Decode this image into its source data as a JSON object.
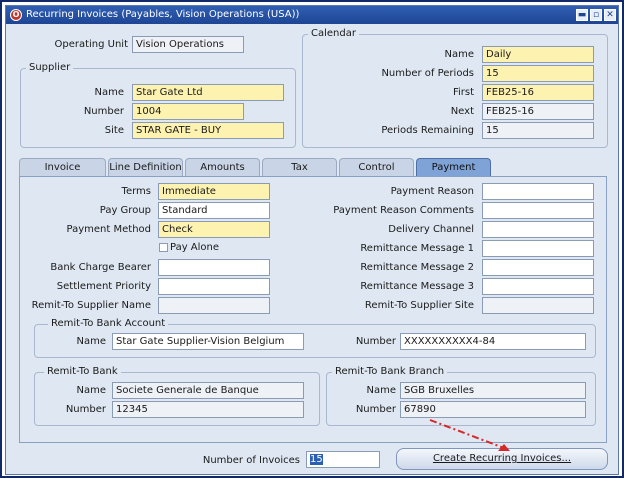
{
  "window": {
    "title": "Recurring Invoices (Payables, Vision Operations (USA))",
    "title_icon": "O",
    "buttons": {
      "minimize": "▬",
      "restore": "▫",
      "close": "✕"
    }
  },
  "header": {
    "operating_unit_label": "Operating Unit",
    "operating_unit_value": "Vision Operations"
  },
  "supplier": {
    "group_title": "Supplier",
    "name_label": "Name",
    "name_value": "Star Gate Ltd",
    "number_label": "Number",
    "number_value": "1004",
    "site_label": "Site",
    "site_value": "STAR GATE - BUY"
  },
  "calendar": {
    "group_title": "Calendar",
    "name_label": "Name",
    "name_value": "Daily",
    "num_periods_label": "Number of Periods",
    "num_periods_value": "15",
    "first_label": "First",
    "first_value": "FEB25-16",
    "next_label": "Next",
    "next_value": "FEB25-16",
    "remaining_label": "Periods Remaining",
    "remaining_value": "15"
  },
  "tabs": [
    {
      "label": "Invoice Definition"
    },
    {
      "label": "Line Definition"
    },
    {
      "label": "Amounts"
    },
    {
      "label": "Tax"
    },
    {
      "label": "Control"
    },
    {
      "label": "Payment"
    }
  ],
  "payment": {
    "terms_label": "Terms",
    "terms_value": "Immediate",
    "pay_group_label": "Pay Group",
    "pay_group_value": "Standard",
    "payment_method_label": "Payment Method",
    "payment_method_value": "Check",
    "pay_alone_label": "Pay Alone",
    "bank_charge_label": "Bank Charge Bearer",
    "bank_charge_value": "",
    "settlement_label": "Settlement Priority",
    "settlement_value": "",
    "remit_supplier_name_label": "Remit-To Supplier Name",
    "remit_supplier_name_value": "",
    "reason_label": "Payment Reason",
    "reason_value": "",
    "reason_comments_label": "Payment Reason Comments",
    "reason_comments_value": "",
    "delivery_label": "Delivery Channel",
    "delivery_value": "",
    "remit_msg1_label": "Remittance Message 1",
    "remit_msg1_value": "",
    "remit_msg2_label": "Remittance Message 2",
    "remit_msg2_value": "",
    "remit_msg3_label": "Remittance Message 3",
    "remit_msg3_value": "",
    "remit_supplier_site_label": "Remit-To Supplier Site",
    "remit_supplier_site_value": ""
  },
  "remit_account": {
    "group_title": "Remit-To Bank Account",
    "name_label": "Name",
    "name_value": "Star Gate Supplier-Vision Belgium",
    "number_label": "Number",
    "number_value": "XXXXXXXXXX4-84"
  },
  "remit_bank": {
    "group_title": "Remit-To Bank",
    "name_label": "Name",
    "name_value": "Societe Generale de Banque",
    "number_label": "Number",
    "number_value": "12345"
  },
  "remit_branch": {
    "group_title": "Remit-To Bank Branch",
    "name_label": "Name",
    "name_value": "SGB  Bruxelles",
    "number_label": "Number",
    "number_value": "67890"
  },
  "footer": {
    "num_invoices_label": "Number of Invoices",
    "num_invoices_value": "15",
    "create_button_label": "Create Recurring Invoices..."
  },
  "colors": {
    "required_field": "#fdf2b0",
    "title_bar": "#1e4594",
    "annotation_arrow": "#d62828"
  }
}
